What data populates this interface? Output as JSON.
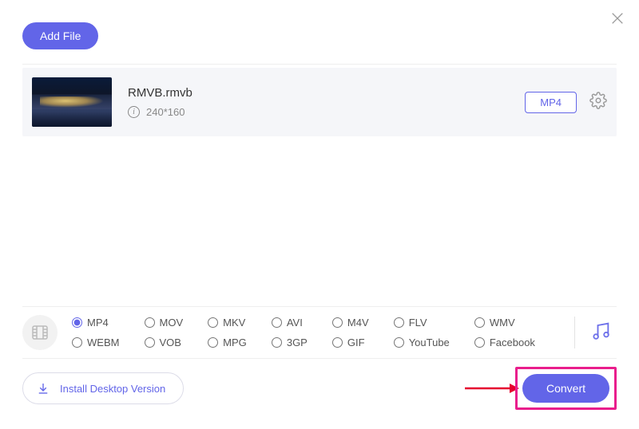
{
  "header": {
    "add_file_label": "Add File"
  },
  "file": {
    "name": "RMVB.rmvb",
    "resolution": "240*160",
    "format_badge": "MP4",
    "info_char": "i"
  },
  "formats": {
    "selected": "MP4",
    "row1": [
      "MP4",
      "MOV",
      "MKV",
      "AVI",
      "M4V",
      "FLV",
      "WMV"
    ],
    "row2": [
      "WEBM",
      "VOB",
      "MPG",
      "3GP",
      "GIF",
      "YouTube",
      "Facebook"
    ]
  },
  "footer": {
    "install_label": "Install Desktop Version",
    "convert_label": "Convert"
  }
}
